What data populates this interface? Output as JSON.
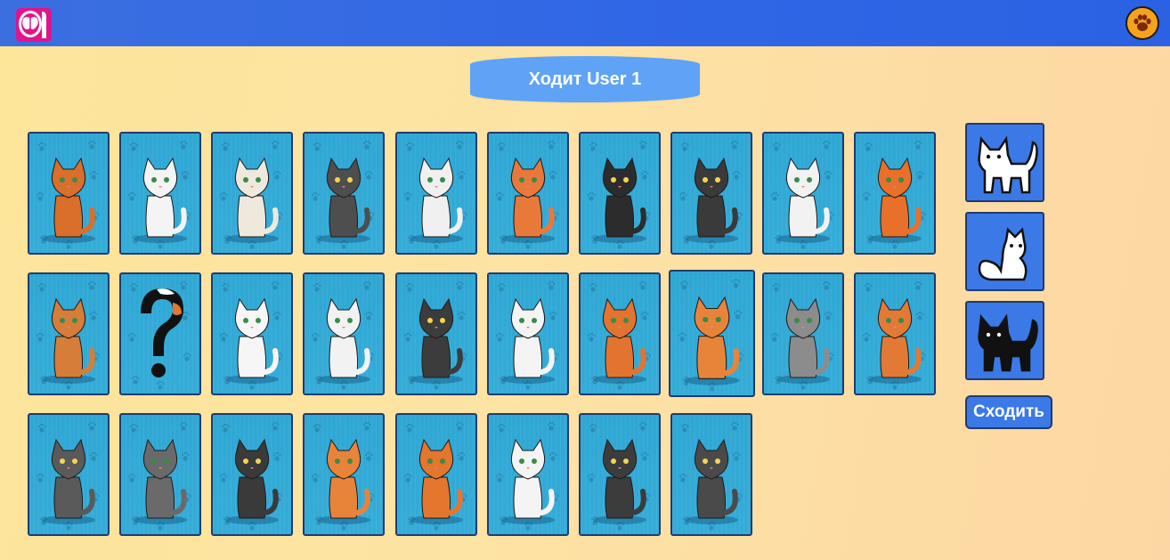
{
  "header": {
    "logo_icon": "brain-logo-icon",
    "settings_icon": "paw-icon"
  },
  "turn": {
    "text": "Ходит User 1"
  },
  "board": {
    "rows": [
      [
        {
          "cat": "ginger-winking",
          "color": "#d96f2a"
        },
        {
          "cat": "white-fluffy",
          "color": "#f4f4f4"
        },
        {
          "cat": "calico-sitting",
          "color": "#efe9dd"
        },
        {
          "cat": "tuxedo-grey-yowling",
          "color": "#4e4e4e"
        },
        {
          "cat": "white-tabby-grey-stripes",
          "color": "#f0f0f0"
        },
        {
          "cat": "orange-spotted",
          "color": "#e8793a"
        },
        {
          "cat": "black-spotted-fangs",
          "color": "#2c2c2c"
        },
        {
          "cat": "black-lying-rug",
          "color": "#3a3a3a"
        },
        {
          "cat": "white-black-spots",
          "color": "#f2f2f2"
        },
        {
          "cat": "ginger-loaf-mouse",
          "color": "#e8702a"
        }
      ],
      [
        {
          "cat": "bengal-leopard",
          "color": "#d77d3a"
        },
        {
          "cat": "question-mark-calico",
          "color": "#111111"
        },
        {
          "cat": "white-playful",
          "color": "#f6f6f6"
        },
        {
          "cat": "white-tabby-rolling-ball",
          "color": "#f2f2f2"
        },
        {
          "cat": "black-sitting-paw-up",
          "color": "#3c3c3c"
        },
        {
          "cat": "white-tabby-hissing",
          "color": "#f4f4f4"
        },
        {
          "cat": "ginger-standing",
          "color": "#e27430"
        },
        {
          "cat": "ginger-tabby-standing",
          "color": "#e8843a"
        },
        {
          "cat": "grey-white-sleeping",
          "color": "#8c8c8c"
        },
        {
          "cat": "ginger-tabby-fish-can",
          "color": "#e27a36"
        }
      ],
      [
        {
          "cat": "grey-scottish-fold",
          "color": "#5a5a5a"
        },
        {
          "cat": "grey-tabby-sitting",
          "color": "#6a6a6a"
        },
        {
          "cat": "black-white-green-eyes",
          "color": "#3a3a3a"
        },
        {
          "cat": "ginger-tabby-grumpy",
          "color": "#e8843a"
        },
        {
          "cat": "calico-lying-yarn",
          "color": "#e4762e"
        },
        {
          "cat": "white-curled-sleeping",
          "color": "#f4f4f4"
        },
        {
          "cat": "black-grey-playing-wand",
          "color": "#3c3c3c"
        },
        {
          "cat": "grey-tabby-loaf",
          "color": "#4a4a4a"
        }
      ]
    ]
  },
  "side_panel": {
    "cards": [
      {
        "name": "white-standing-cat",
        "fill": "#ffffff"
      },
      {
        "name": "white-sitting-cat",
        "fill": "#ffffff"
      },
      {
        "name": "black-standing-cat",
        "fill": "#111111"
      }
    ],
    "move_label": "Сходить"
  },
  "colors": {
    "header_blue": "#2f66e6",
    "banner_blue": "#5fa3f7",
    "card_blue": "#31a9d6",
    "side_blue": "#3a79e6",
    "border_navy": "#1f3b6e",
    "logo_pink": "#e0148c",
    "paw_orange": "#f6a21c"
  }
}
